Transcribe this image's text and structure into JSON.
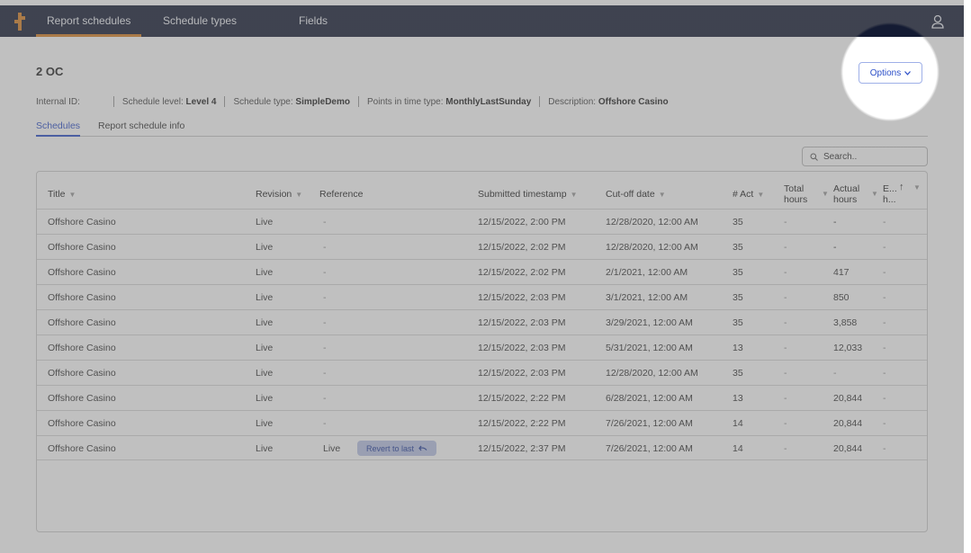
{
  "nav": {
    "tabs": [
      {
        "label": "Report schedules"
      },
      {
        "label": "Schedule types"
      },
      {
        "label": "Fields"
      }
    ],
    "user_icon": "user-icon",
    "accent": "#d78126"
  },
  "page": {
    "title": "2 OC",
    "options_label": "Options",
    "meta": {
      "internal_id_label": "Internal ID:",
      "schedule_level_label": "Schedule level:",
      "schedule_level_value": "Level 4",
      "schedule_type_label": "Schedule type:",
      "schedule_type_value": "SimpleDemo",
      "points_label": "Points in time type:",
      "points_value": "MonthlyLastSunday",
      "description_label": "Description:",
      "description_value": "Offshore Casino"
    },
    "subtabs": [
      {
        "label": "Schedules"
      },
      {
        "label": "Report schedule info"
      }
    ],
    "search_placeholder": "Search.."
  },
  "table": {
    "headers": {
      "title": "Title",
      "revision": "Revision",
      "reference": "Reference",
      "submitted": "Submitted timestamp",
      "cutoff": "Cut-off date",
      "act": "# Act",
      "total_1": "Total",
      "total_2": "hours",
      "actual_1": "Actual",
      "actual_2": "hours",
      "e_1": "E...",
      "e_2": "h..."
    },
    "revert_label": "Revert to last",
    "rows": [
      {
        "title": "Offshore Casino",
        "revision": "Live",
        "reference": "-",
        "submitted": "12/15/2022, 2:00 PM",
        "cutoff": "12/28/2020, 12:00 AM",
        "act": "35",
        "total": "-",
        "actual": "-",
        "e": "-"
      },
      {
        "title": "Offshore Casino",
        "revision": "Live",
        "reference": "-",
        "submitted": "12/15/2022, 2:02 PM",
        "cutoff": "12/28/2020, 12:00 AM",
        "act": "35",
        "total": "-",
        "actual": "-",
        "e": "-"
      },
      {
        "title": "Offshore Casino",
        "revision": "Live",
        "reference": "-",
        "submitted": "12/15/2022, 2:02 PM",
        "cutoff": "2/1/2021, 12:00 AM",
        "act": "35",
        "total": "-",
        "actual": "417",
        "e": "-"
      },
      {
        "title": "Offshore Casino",
        "revision": "Live",
        "reference": "-",
        "submitted": "12/15/2022, 2:03 PM",
        "cutoff": "3/1/2021, 12:00 AM",
        "act": "35",
        "total": "-",
        "actual": "850",
        "e": "-"
      },
      {
        "title": "Offshore Casino",
        "revision": "Live",
        "reference": "-",
        "submitted": "12/15/2022, 2:03 PM",
        "cutoff": "3/29/2021, 12:00 AM",
        "act": "35",
        "total": "-",
        "actual": "3,858",
        "e": "-"
      },
      {
        "title": "Offshore Casino",
        "revision": "Live",
        "reference": "-",
        "submitted": "12/15/2022, 2:03 PM",
        "cutoff": "5/31/2021, 12:00 AM",
        "act": "13",
        "total": "-",
        "actual": "12,033",
        "e": "-"
      },
      {
        "title": "Offshore Casino",
        "revision": "Live",
        "reference": "-",
        "submitted": "12/15/2022, 2:03 PM",
        "cutoff": "12/28/2020, 12:00 AM",
        "act": "35",
        "total": "-",
        "actual": "-",
        "e": "-"
      },
      {
        "title": "Offshore Casino",
        "revision": "Live",
        "reference": "-",
        "submitted": "12/15/2022, 2:22 PM",
        "cutoff": "6/28/2021, 12:00 AM",
        "act": "13",
        "total": "-",
        "actual": "20,844",
        "e": "-"
      },
      {
        "title": "Offshore Casino",
        "revision": "Live",
        "reference": "-",
        "submitted": "12/15/2022, 2:22 PM",
        "cutoff": "7/26/2021, 12:00 AM",
        "act": "14",
        "total": "-",
        "actual": "20,844",
        "e": "-"
      },
      {
        "title": "Offshore Casino",
        "revision": "Live",
        "reference": "Live",
        "submitted": "12/15/2022, 2:37 PM",
        "cutoff": "7/26/2021, 12:00 AM",
        "act": "14",
        "total": "-",
        "actual": "20,844",
        "e": "-"
      }
    ]
  }
}
